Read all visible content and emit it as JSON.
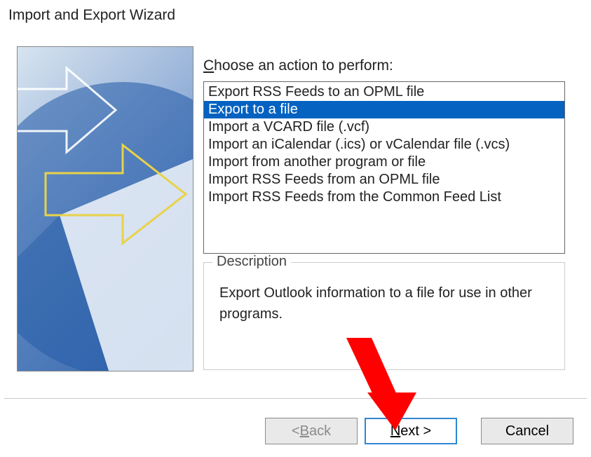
{
  "title": "Import and Export Wizard",
  "action_label_pre": "C",
  "action_label_rest": "hoose an action to perform:",
  "actions": [
    {
      "label": "Export RSS Feeds to an OPML file",
      "selected": false
    },
    {
      "label": "Export to a file",
      "selected": true
    },
    {
      "label": "Import a VCARD file (.vcf)",
      "selected": false
    },
    {
      "label": "Import an iCalendar (.ics) or vCalendar file (.vcs)",
      "selected": false
    },
    {
      "label": "Import from another program or file",
      "selected": false
    },
    {
      "label": "Import RSS Feeds from an OPML file",
      "selected": false
    },
    {
      "label": "Import RSS Feeds from the Common Feed List",
      "selected": false
    }
  ],
  "description": {
    "legend": "Description",
    "text": "Export Outlook information to a file for use in other programs."
  },
  "buttons": {
    "back_pre": "< ",
    "back_u": "B",
    "back_post": "ack",
    "next_u": "N",
    "next_post": "ext >",
    "cancel": "Cancel"
  }
}
